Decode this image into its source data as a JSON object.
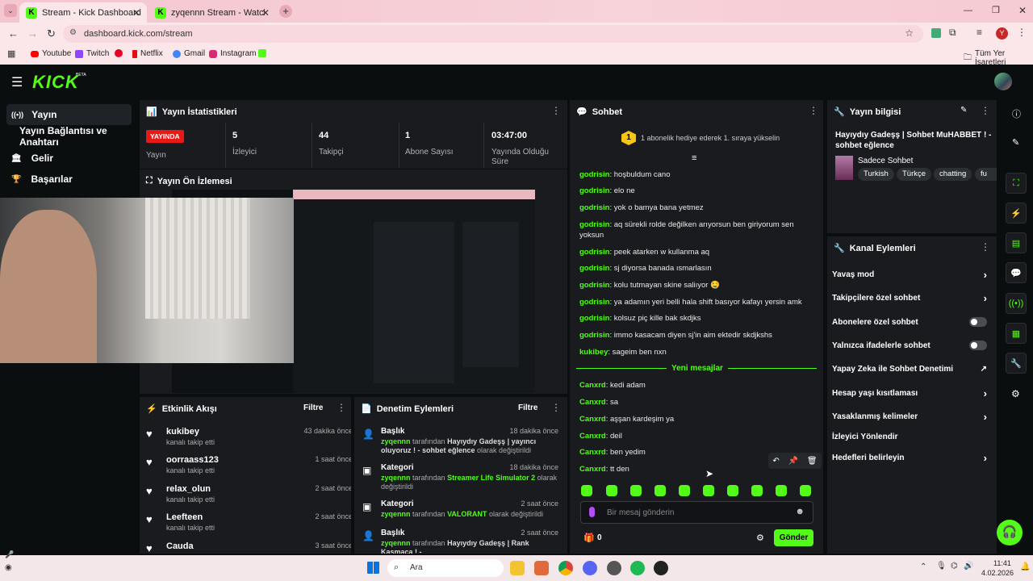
{
  "browser": {
    "tabs": [
      {
        "label": "Stream - Kick Dashboard"
      },
      {
        "label": "zyqennn Stream - Watch Live o"
      }
    ],
    "url": "dashboard.kick.com/stream",
    "bookmarks": [
      "Youtube",
      "Twitch",
      "Netflix",
      "Gmail",
      "Instagram"
    ],
    "bookmarks_folder": "Tüm Yer İşaretleri",
    "profile_letter": "Y"
  },
  "sidebar": {
    "items": [
      {
        "label": "Yayın",
        "icon": "broadcast-icon"
      },
      {
        "label": "Yayın Bağlantısı ve Anahtarı",
        "icon": ""
      },
      {
        "label": "Gelir",
        "icon": "bank-icon"
      },
      {
        "label": "Başarılar",
        "icon": "trophy-icon"
      }
    ]
  },
  "stats": {
    "title": "Yayın İstatistikleri",
    "live_badge": "YAYINDA",
    "live_label": "Yayın",
    "items": [
      {
        "value": "5",
        "label": "İzleyici"
      },
      {
        "value": "44",
        "label": "Takipçi"
      },
      {
        "value": "1",
        "label": "Abone Sayısı"
      },
      {
        "value": "03:47:00",
        "label": "Yayında Olduğu Süre"
      }
    ]
  },
  "preview": {
    "title": "Yayın Ön İzlemesi"
  },
  "activity": {
    "title": "Etkinlik Akışı",
    "filter": "Filtre",
    "items": [
      {
        "name": "kukibey",
        "sub": "kanalı takip etti",
        "time": "43 dakika önce"
      },
      {
        "name": "oorraass123",
        "sub": "kanalı takip etti",
        "time": "1 saat önce"
      },
      {
        "name": "relax_olun",
        "sub": "kanalı takip etti",
        "time": "2 saat önce"
      },
      {
        "name": "Leefteen",
        "sub": "kanalı takip etti",
        "time": "2 saat önce"
      },
      {
        "name": "Cauda",
        "sub": "",
        "time": "3 saat önce"
      }
    ]
  },
  "moderation": {
    "title": "Denetim Eylemleri",
    "filter": "Filtre",
    "items": [
      {
        "type": "Başlık",
        "time": "18 dakika önce",
        "user": "zyqennn",
        "mid": "tarafından",
        "value": "Hayıydıy Gadeşş | yayıncı oluyoruz ! - sohbet eğlence",
        "tail": "olarak değiştirildi"
      },
      {
        "type": "Kategori",
        "time": "18 dakika önce",
        "user": "zyqennn",
        "mid": "tarafından",
        "value": "Streamer Life Simulator 2",
        "tail": "olarak değiştirildi"
      },
      {
        "type": "Kategori",
        "time": "2 saat önce",
        "user": "zyqennn",
        "mid": "tarafından",
        "value": "VALORANT",
        "tail": "olarak değiştirildi"
      },
      {
        "type": "Başlık",
        "time": "2 saat önce",
        "user": "zyqennn",
        "mid": "tarafından",
        "value": "Hayıydıy Gadeşş | Rank Kasmaca ! -",
        "tail": ""
      }
    ]
  },
  "chat": {
    "title": "Sohbet",
    "banner_rank": "1",
    "banner": "1 abonelik hediye ederek 1. sıraya yükselin",
    "messages": [
      {
        "user": "godrisin",
        "text": "hoşbuldum cano"
      },
      {
        "user": "godrisin",
        "text": "elo ne"
      },
      {
        "user": "godrisin",
        "text": "yok o bamya bana yetmez"
      },
      {
        "user": "godrisin",
        "text": "aq sürekli rolde değilken arıyorsun ben giriyorum sen yoksun"
      },
      {
        "user": "godrisin",
        "text": "peek atarken w kullanma aq"
      },
      {
        "user": "godrisin",
        "text": "sj diyorsa banada ısmarlasın"
      },
      {
        "user": "godrisin",
        "text": "kolu tutmayan skine saliıyor 🤤"
      },
      {
        "user": "godrisin",
        "text": "ya adamın yeri belli hala shift basıyor kafayı yersin amk"
      },
      {
        "user": "godrisin",
        "text": "kolsuz piç kille bak skdjks"
      },
      {
        "user": "godrisin",
        "text": "immo kasacam diyen sj'in aim ektedir skdjkshs"
      },
      {
        "user": "kukibey",
        "text": "sageim ben nxn"
      }
    ],
    "new_divider": "Yeni mesajlar",
    "new_messages": [
      {
        "user": "Canxrd",
        "text": "kedi adam"
      },
      {
        "user": "Canxrd",
        "text": "sa"
      },
      {
        "user": "Canxrd",
        "text": "aşşan kardeşim ya"
      },
      {
        "user": "Canxrd",
        "text": "deil"
      },
      {
        "user": "Canxrd",
        "text": "ben yedim"
      },
      {
        "user": "Canxrd",
        "text": "tt den"
      }
    ],
    "input_placeholder": "Bir mesaj gönderin",
    "points": "0",
    "send": "Gönder"
  },
  "info": {
    "title": "Yayın bilgisi",
    "stream_title": "Hayıydıy Gadeşş | Sohbet MuHABBET ! - sohbet eğlence",
    "category": "Sadece Sohbet",
    "tags": [
      "Turkish",
      "Türkçe",
      "chatting",
      "fu"
    ]
  },
  "channel_actions": {
    "title": "Kanal Eylemleri",
    "items": [
      {
        "label": "Yavaş mod",
        "control": "chevron"
      },
      {
        "label": "Takipçilere özel sohbet",
        "control": "chevron"
      },
      {
        "label": "Abonelere özel sohbet",
        "control": "toggle"
      },
      {
        "label": "Yalnızca ifadelerle sohbet",
        "control": "toggle"
      },
      {
        "label": "Yapay Zeka ile Sohbet Denetimi",
        "control": "external"
      },
      {
        "label": "Hesap yaşı kısıtlaması",
        "control": "chevron"
      },
      {
        "label": "Yasaklanmış kelimeler",
        "control": "chevron"
      },
      {
        "label": "İzleyici Yönlendir",
        "control": "none"
      },
      {
        "label": "Hedefleri belirleyin",
        "control": "chevron"
      }
    ]
  },
  "taskbar": {
    "search": "Ara",
    "time": "11:41",
    "date": "4.02.2026"
  },
  "colors": {
    "accent": "#53fc18",
    "panel": "#191b1f",
    "bg": "#0b0e0f",
    "live": "#e91916"
  }
}
